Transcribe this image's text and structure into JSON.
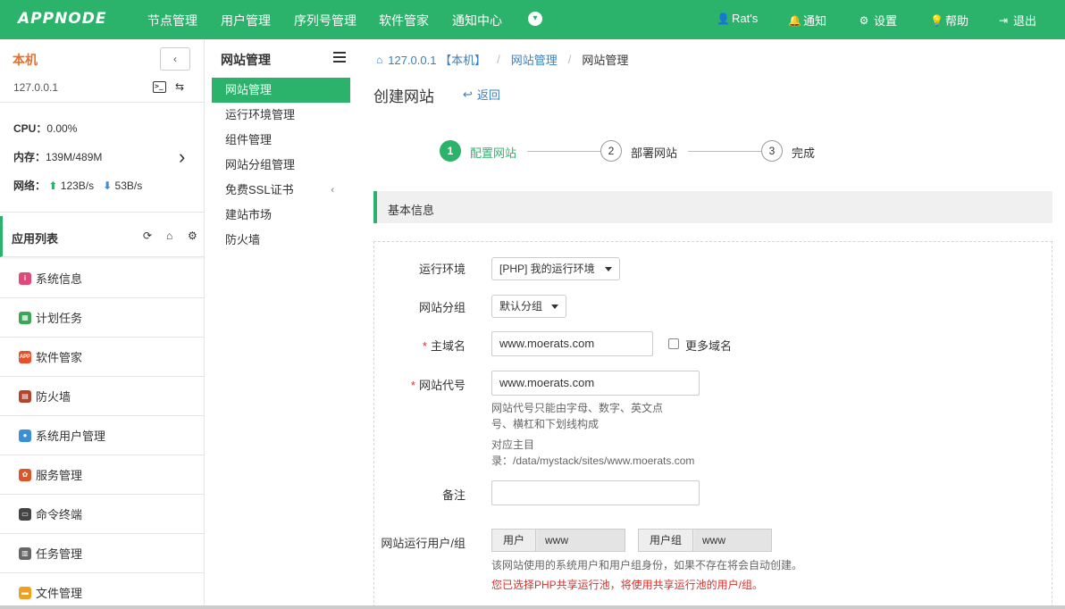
{
  "topbar": {
    "logo": "APPNODE",
    "nav": [
      "节点管理",
      "用户管理",
      "序列号管理",
      "软件管家",
      "通知中心"
    ],
    "user": "Rat's",
    "notify": "通知",
    "settings": "设置",
    "help": "帮助",
    "logout": "退出",
    "accent": "#2cb36b"
  },
  "host": {
    "name": "本机",
    "ip": "127.0.0.1",
    "cpu_label": "CPU：",
    "cpu_value": "0.00%",
    "mem_label": "内存：",
    "mem_value": "139M/489M",
    "net_label": "网络：",
    "net_up": "123B/s",
    "net_down": "53B/s"
  },
  "applist": {
    "title": "应用列表",
    "items": [
      {
        "label": "系统信息",
        "icon": "info-icon",
        "color": "#e04a7b"
      },
      {
        "label": "计划任务",
        "icon": "calendar-icon",
        "color": "#3aa757"
      },
      {
        "label": "软件管家",
        "icon": "app-icon",
        "color": "#e8502a"
      },
      {
        "label": "防火墙",
        "icon": "firewall-icon",
        "color": "#b5452a"
      },
      {
        "label": "系统用户管理",
        "icon": "user-icon",
        "color": "#3a8fd9"
      },
      {
        "label": "服务管理",
        "icon": "service-icon",
        "color": "#d9562a"
      },
      {
        "label": "命令终端",
        "icon": "terminal-icon",
        "color": "#444444"
      },
      {
        "label": "任务管理",
        "icon": "task-icon",
        "color": "#666666"
      },
      {
        "label": "文件管理",
        "icon": "folder-icon",
        "color": "#f0a020"
      }
    ]
  },
  "subpanel": {
    "title": "网站管理",
    "items": [
      "网站管理",
      "运行环境管理",
      "组件管理",
      "网站分组管理",
      "免费SSL证书",
      "建站市场",
      "防火墙"
    ]
  },
  "breadcrumb": {
    "host": "127.0.0.1 【本机】",
    "section": "网站管理",
    "current": "网站管理"
  },
  "page": {
    "title": "创建网站",
    "back": "返回"
  },
  "steps": [
    {
      "num": "1",
      "label": "配置网站"
    },
    {
      "num": "2",
      "label": "部署网站"
    },
    {
      "num": "3",
      "label": "完成"
    }
  ],
  "section": {
    "title": "基本信息"
  },
  "form": {
    "env_label": "运行环境",
    "env_value": "[PHP] 我的运行环境",
    "group_label": "网站分组",
    "group_value": "默认分组",
    "domain_label": "主域名",
    "domain_value": "www.moerats.com",
    "more_domains": "更多域名",
    "code_label": "网站代号",
    "code_value": "www.moerats.com",
    "code_help_1": "网站代号只能由字母、数字、英文点",
    "code_help_2": "号、横杠和下划线构成",
    "dir_help_1": "对应主目",
    "dir_help_2": "录：/data/mystack/sites/www.moerats.com",
    "note_label": "备注",
    "note_value": "",
    "runuser_label": "网站运行用户/组",
    "user_addon": "用户",
    "user_value": "www",
    "group_addon": "用户组",
    "usergroup_value": "www",
    "runuser_help": "该网站使用的系统用户和用户组身份，如果不存在将会自动创建。",
    "runuser_warn": "您已选择PHP共享运行池，将使用共享运行池的用户/组。"
  }
}
